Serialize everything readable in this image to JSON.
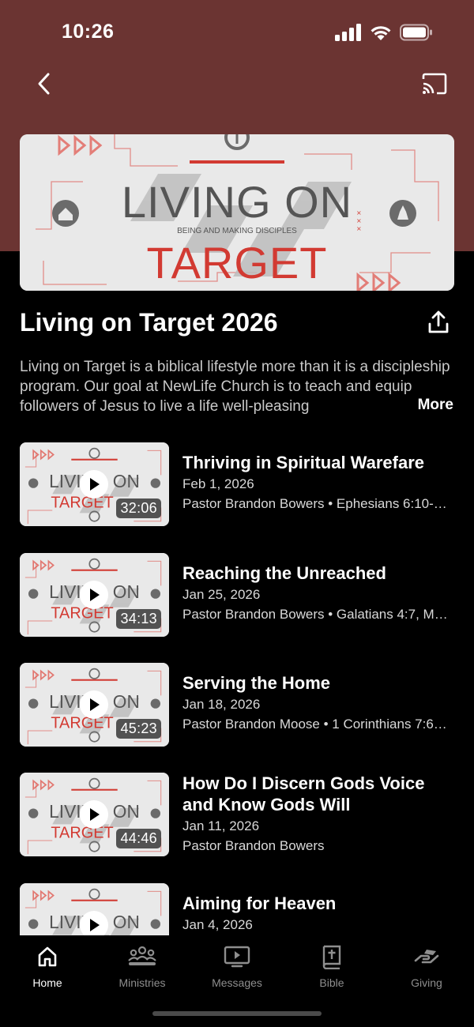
{
  "status_bar": {
    "time": "10:26"
  },
  "colors": {
    "header_bg": "#6b3432",
    "accent_red": "#d23a32",
    "background": "#000000",
    "text_muted": "#c9c9c9"
  },
  "series": {
    "artwork": {
      "line1": "LIVING ON",
      "tagline": "BEING AND MAKING DISCIPLES",
      "line2": "TARGET"
    },
    "title": "Living on Target 2026",
    "description": "Living on Target is a biblical lifestyle more than it is a discipleship program. Our goal at NewLife Church is to teach and equip followers of Jesus to live a life well-pleasing",
    "more_label": "More"
  },
  "episodes": [
    {
      "title": "Thriving in Spiritual Warefare",
      "date": "Feb 1, 2026",
      "meta": "Pastor Brandon Bowers • Ephesians 6:10-…",
      "duration": "32:06"
    },
    {
      "title": "Reaching the Unreached",
      "date": "Jan 25, 2026",
      "meta": "Pastor Brandon Bowers • Galatians 4:7, M…",
      "duration": "34:13"
    },
    {
      "title": "Serving the Home",
      "date": "Jan 18, 2026",
      "meta": "Pastor Brandon Moose • 1 Corinthians 7:6…",
      "duration": "45:23"
    },
    {
      "title": "How Do I Discern Gods Voice and Know Gods Will",
      "date": "Jan 11, 2026",
      "meta": "Pastor Brandon Bowers",
      "duration": "44:46"
    },
    {
      "title": "Aiming for Heaven",
      "date": "Jan 4, 2026",
      "meta": "",
      "duration": ""
    }
  ],
  "tabs": [
    {
      "label": "Home",
      "icon": "home-icon",
      "active": true
    },
    {
      "label": "Ministries",
      "icon": "people-icon",
      "active": false
    },
    {
      "label": "Messages",
      "icon": "tv-play-icon",
      "active": false
    },
    {
      "label": "Bible",
      "icon": "bible-icon",
      "active": false
    },
    {
      "label": "Giving",
      "icon": "giving-hand-icon",
      "active": false
    }
  ]
}
